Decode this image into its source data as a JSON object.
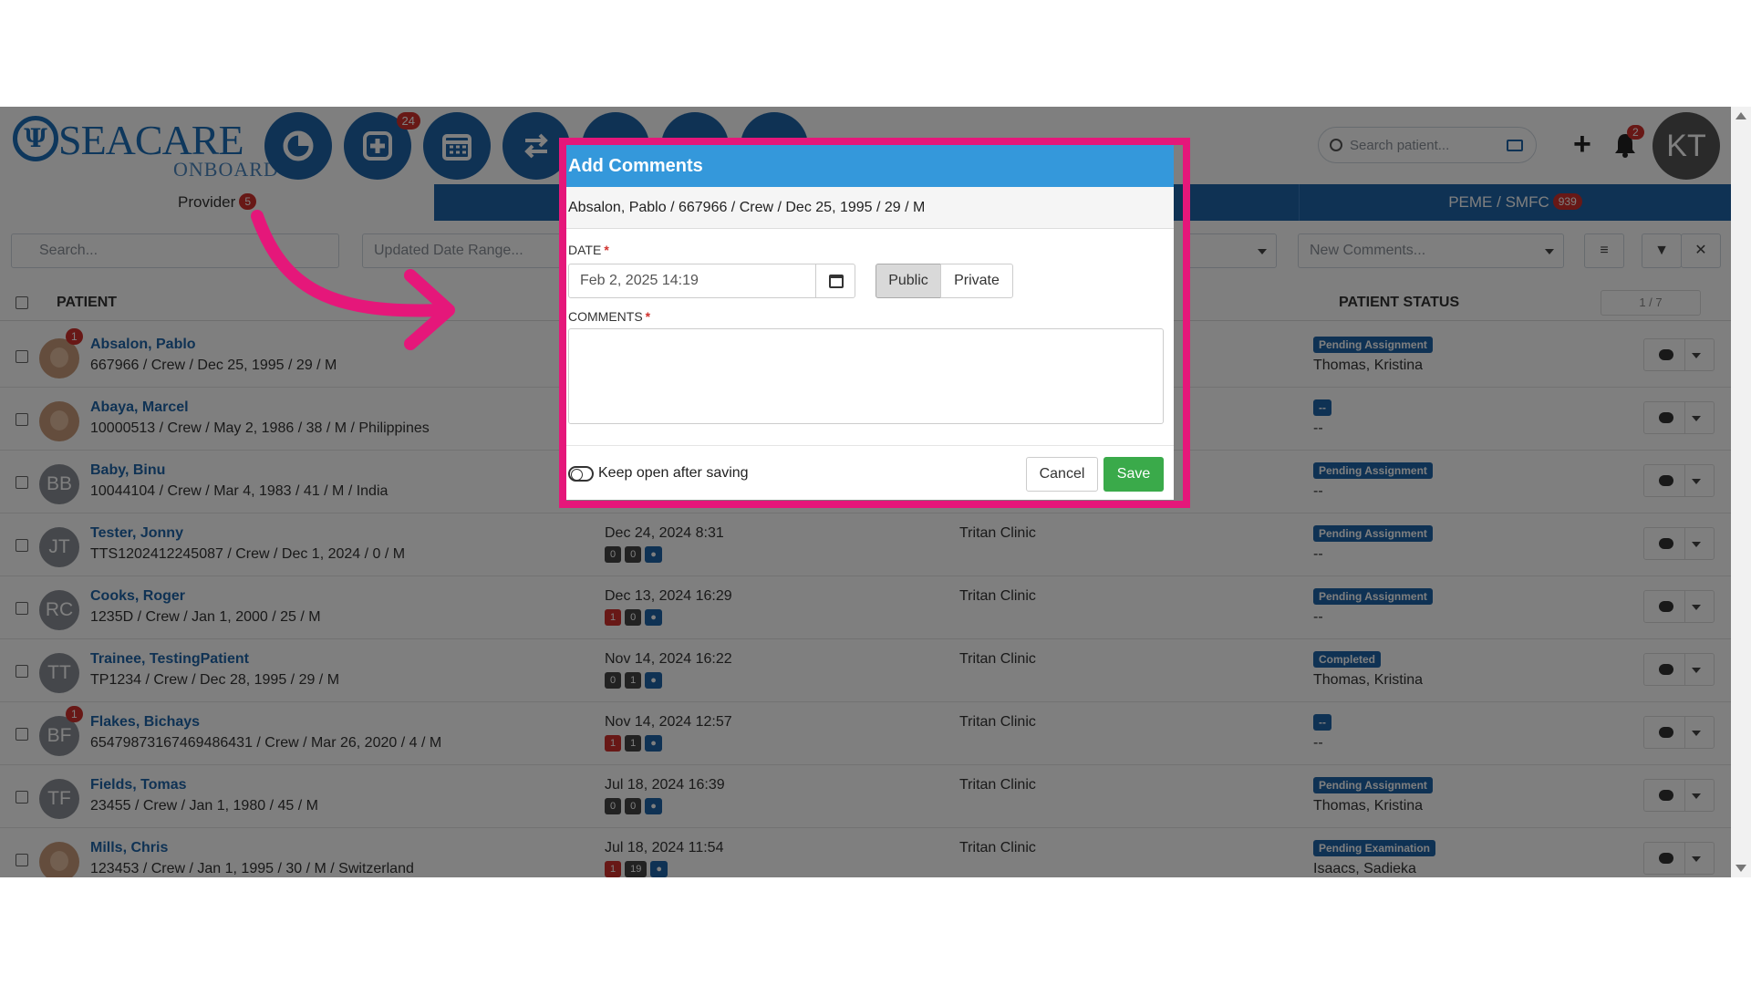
{
  "header": {
    "logo_text": "SEACARE",
    "logo_sub": "ONBOARD",
    "nav_badge": "24",
    "search_placeholder": "Search patient...",
    "bell_badge": "2",
    "user_initials": "KT"
  },
  "tabs": [
    {
      "label": "Provider",
      "badge": "5"
    },
    {
      "label": "PEME / SMFC",
      "badge": "939"
    }
  ],
  "filters": {
    "search_placeholder": "Search...",
    "date_range_placeholder": "Updated Date Range...",
    "comments_placeholder": "New Comments..."
  },
  "table": {
    "col_patient": "PATIENT",
    "col_status": "PATIENT STATUS",
    "pager": "1 / 7",
    "rows": [
      {
        "initials": "",
        "photo": true,
        "badge": "1",
        "name": "Absalon, Pablo",
        "details": "667966 / Crew / Dec 25, 1995 / 29 / M",
        "date": "",
        "chips": [],
        "clinic": "",
        "status": "Pending Assignment",
        "assignee": "Thomas, Kristina"
      },
      {
        "initials": "",
        "photo": true,
        "badge": "",
        "name": "Abaya, Marcel",
        "details": "10000513 / Crew / May 2, 1986 / 38 / M / Philippines",
        "date": "",
        "chips": [],
        "clinic": "",
        "status": "--",
        "assignee": "--"
      },
      {
        "initials": "BB",
        "photo": false,
        "badge": "",
        "name": "Baby, Binu",
        "details": "10044104 / Crew / Mar 4, 1983 / 41 / M / India",
        "date": "",
        "chips": [],
        "clinic": "",
        "status": "Pending Assignment",
        "assignee": "--"
      },
      {
        "initials": "JT",
        "photo": false,
        "badge": "",
        "name": "Tester, Jonny",
        "details": "TTS1202412245087 / Crew / Dec 1, 2024 / 0 / M",
        "date": "Dec 24, 2024 8:31",
        "chips": [
          "0",
          "0"
        ],
        "clinic": "Tritan Clinic",
        "status": "Pending Assignment",
        "assignee": "--"
      },
      {
        "initials": "RC",
        "photo": false,
        "badge": "",
        "name": "Cooks, Roger",
        "details": "1235D / Crew / Jan 1, 2000 / 25 / M",
        "date": "Dec 13, 2024 16:29",
        "chips": [
          "1",
          "0"
        ],
        "clinic": "Tritan Clinic",
        "status": "Pending Assignment",
        "assignee": "--"
      },
      {
        "initials": "TT",
        "photo": false,
        "badge": "",
        "name": "Trainee, TestingPatient",
        "details": "TP1234 / Crew / Dec 28, 1995 / 29 / M",
        "date": "Nov 14, 2024 16:22",
        "chips": [
          "0",
          "1"
        ],
        "clinic": "Tritan Clinic",
        "status": "Completed",
        "assignee": "Thomas, Kristina"
      },
      {
        "initials": "BF",
        "photo": false,
        "badge": "1",
        "name": "Flakes, Bichays",
        "details": "65479873167469486431 / Crew / Mar 26, 2020 / 4 / M",
        "date": "Nov 14, 2024 12:57",
        "chips": [
          "1",
          "1"
        ],
        "clinic": "Tritan Clinic",
        "status": "--",
        "assignee": "--"
      },
      {
        "initials": "TF",
        "photo": false,
        "badge": "",
        "name": "Fields, Tomas",
        "details": "23455 / Crew / Jan 1, 1980 / 45 / M",
        "date": "Jul 18, 2024 16:39",
        "chips": [
          "0",
          "0"
        ],
        "clinic": "Tritan Clinic",
        "status": "Pending Assignment",
        "assignee": "Thomas, Kristina"
      },
      {
        "initials": "",
        "photo": true,
        "badge": "",
        "name": "Mills, Chris",
        "details": "123453 / Crew / Jan 1, 1995 / 30 / M / Switzerland",
        "date": "Jul 18, 2024 11:54",
        "chips": [
          "1",
          "19"
        ],
        "clinic": "Tritan Clinic",
        "status": "Pending Examination",
        "assignee": "Isaacs, Sadieka"
      }
    ]
  },
  "modal": {
    "title": "Add Comments",
    "subtitle": "Absalon, Pablo / 667966 / Crew / Dec 25, 1995 / 29 / M",
    "date_label": "DATE",
    "date_value": "Feb 2, 2025 14:19",
    "public_label": "Public",
    "private_label": "Private",
    "comments_label": "COMMENTS",
    "comments_value": "",
    "keep_open_label": "Keep open after saving",
    "cancel_label": "Cancel",
    "save_label": "Save"
  },
  "colors": {
    "brand": "#1e64a8",
    "modal_header": "#3498db",
    "highlight": "#e5177a",
    "save": "#3aaa4a"
  }
}
